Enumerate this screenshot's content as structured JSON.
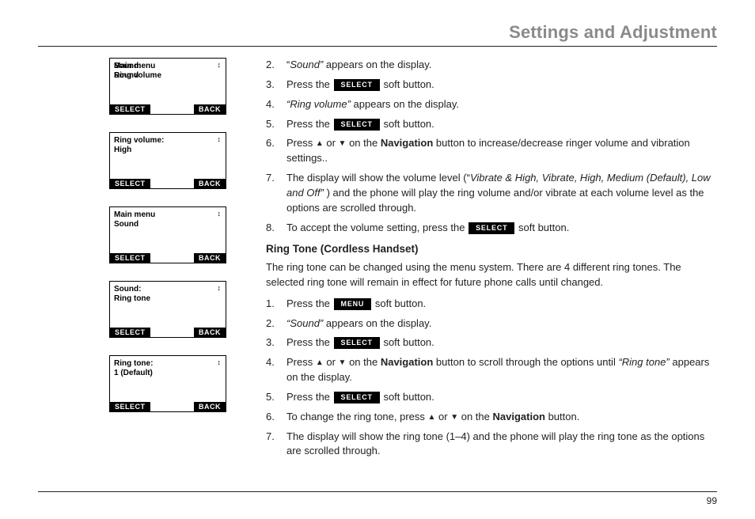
{
  "page": {
    "title": "Settings and Adjustment",
    "number": "99"
  },
  "buttons": {
    "select": "SELECT",
    "back": "BACK",
    "menu": "MENU"
  },
  "screens": [
    {
      "line1": "Main menu",
      "line2": "Sound",
      "ov1": "Sound:",
      "ov2": "Ring volume"
    },
    {
      "line1": "Ring volume:",
      "line2": "High"
    },
    {
      "line1": "Main menu",
      "line2": "Sound"
    },
    {
      "line1": "Sound:",
      "line2": "Ring tone"
    },
    {
      "line1": "Ring tone:",
      "line2": "1 (Default)"
    }
  ],
  "stepsA": {
    "s2": {
      "n": "2.",
      "pre": "“",
      "it": "Sound”",
      "post": " appears on the display."
    },
    "s3": {
      "n": "3.",
      "pre": "Press the ",
      "post": " soft button."
    },
    "s4": {
      "n": "4.",
      "it": "“Ring volume”",
      "post": " appears on the display."
    },
    "s5": {
      "n": "5.",
      "pre": "Press the ",
      "post": " soft button."
    },
    "s6": {
      "n": "6.",
      "pre": "Press ",
      "mid": " or  ",
      "post1": " on the ",
      "bold": "Navigation",
      "post2": " button to increase/decrease ringer volume and vibration settings.."
    },
    "s7": {
      "n": "7.",
      "pre": "The display will show the volume level (“",
      "it": "Vibrate & High, Vibrate, High, Medium (Default), Low and Off”",
      "post": " ) and the phone will play the ring volume and/or vibrate at each volume level as the options are scrolled through."
    },
    "s8": {
      "n": "8.",
      "pre": "To accept the volume setting, press the ",
      "post": " soft button."
    }
  },
  "sectionB": {
    "heading": "Ring Tone (Cordless Handset)",
    "intro": "The ring tone can be changed using the menu system. There are 4 different ring tones. The selected ring tone will remain in effect for future phone calls until changed."
  },
  "stepsB": {
    "s1": {
      "n": "1.",
      "pre": "Press the ",
      "post": " soft button."
    },
    "s2": {
      "n": "2.",
      "it": "“Sound”",
      "post": " appears on the display."
    },
    "s3": {
      "n": "3.",
      "pre": "Press the ",
      "post": " soft button."
    },
    "s4": {
      "n": "4.",
      "pre": "Press ",
      "mid": "  or ",
      "post1": " on the ",
      "bold": "Navigation",
      "post2": " button to scroll through the options until ",
      "it": "“Ring tone”",
      "post3": " appears on the display."
    },
    "s5": {
      "n": "5.",
      "pre": "Press the ",
      "post": " soft button."
    },
    "s6": {
      "n": "6.",
      "pre": "To change the ring tone, press ",
      "mid": "  or ",
      "post1": " on the ",
      "bold": "Navigation",
      "post2": " button."
    },
    "s7": {
      "n": "7.",
      "pre": "The display will show the ring tone (1–4) and the phone will play the ring tone as the options are scrolled through."
    }
  }
}
